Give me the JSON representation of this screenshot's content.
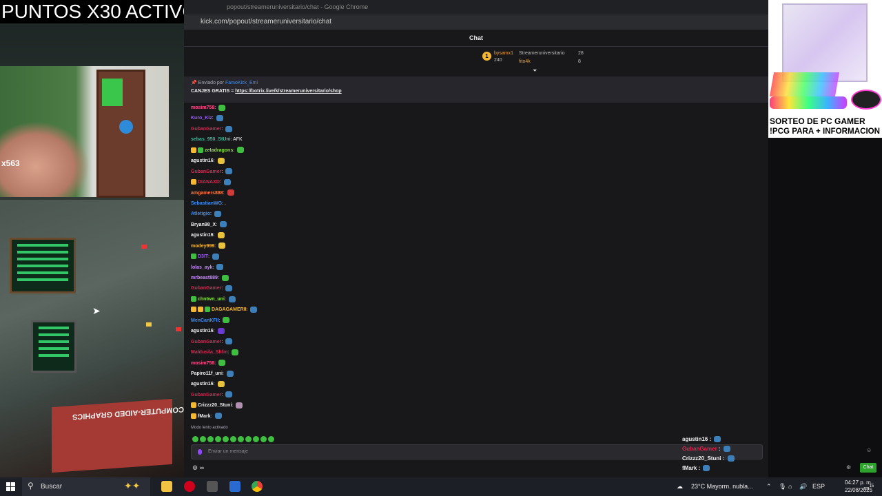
{
  "overlay": {
    "points_banner": "PUNTOS X30 ACTIVOS",
    "webcam_badge": "x563",
    "machine_sign": "COMPUTER-AIDED GRAPHICS",
    "promo_line1": "SORTEO DE PC GAMER",
    "promo_line2": "!PCG PARA + INFORMACION"
  },
  "browser": {
    "title": "popout/streameruniversitario/chat - Google Chrome",
    "url": "kick.com/popout/streameruniversitario/chat"
  },
  "chat": {
    "header": "Chat",
    "leaderboard": {
      "rank": "1",
      "user1": "bysamx1",
      "pts1": "240",
      "user2": "Streameruniversitario",
      "pts2": "28",
      "user3": "fito4k",
      "pts3": "8"
    },
    "pinned": {
      "sent_by_label": "Enviado por",
      "sent_by_user": "FamoKick_Emi",
      "text": "CANJES GRATIS",
      "link": "https://botrix.live/k/streameruniversitario/shop"
    },
    "messages": [
      {
        "user": "mosim758",
        "color": "#ff4f8b",
        "text": "",
        "emote": "#3fbf3f",
        "badges": []
      },
      {
        "user": "Kuro_Kiz",
        "color": "#9b5bff",
        "text": "",
        "emote": "#3d7fb8",
        "badges": []
      },
      {
        "user": "GubanGamer",
        "color": "#e0244f",
        "text": "",
        "emote": "#3d7fb8",
        "badges": []
      },
      {
        "user": "sebas_950_StUni",
        "color": "#2fbf9a",
        "text": "AFK",
        "emote": "",
        "badges": []
      },
      {
        "user": "zetadragons",
        "color": "#8be33a",
        "text": "",
        "emote": "#3fbf3f",
        "badges": [
          "#f5b82e",
          "#3fbf3f"
        ]
      },
      {
        "user": "agustin16",
        "color": "#efeff1",
        "text": "",
        "emote": "#e8c23a",
        "badges": []
      },
      {
        "user": "GubanGamer",
        "color": "#e0244f",
        "text": "",
        "emote": "#3d7fb8",
        "badges": []
      },
      {
        "user": "DIANAXD",
        "color": "#e0244f",
        "text": "",
        "emote": "#3d7fb8",
        "badges": [
          "#f5b82e"
        ]
      },
      {
        "user": "amgamers888",
        "color": "#ff7a3a",
        "text": "",
        "emote": "#d33a3a",
        "badges": []
      },
      {
        "user": "SebastianWG",
        "color": "#3c8ff5",
        "text": ".",
        "emote": "",
        "badges": []
      },
      {
        "user": "Atletigio",
        "color": "#3c8ff5",
        "text": "",
        "emote": "#3d7fb8",
        "badges": []
      },
      {
        "user": "Bryan98_X",
        "color": "#efeff1",
        "text": "",
        "emote": "#3d7fb8",
        "badges": []
      },
      {
        "user": "agustin16",
        "color": "#efeff1",
        "text": "",
        "emote": "#e8c23a",
        "badges": []
      },
      {
        "user": "modey999",
        "color": "#f5b82e",
        "text": "",
        "emote": "#e8c23a",
        "badges": []
      },
      {
        "user": "D3IT",
        "color": "#9b5bff",
        "text": "",
        "emote": "#3d7fb8",
        "badges": [
          "#3fbf3f"
        ]
      },
      {
        "user": "lolas_ayk",
        "color": "#c98bff",
        "text": "",
        "emote": "#3d7fb8",
        "badges": []
      },
      {
        "user": "mrbeast889",
        "color": "#c98bff",
        "text": "",
        "emote": "#3fbf3f",
        "badges": []
      },
      {
        "user": "GubanGamer",
        "color": "#e0244f",
        "text": "",
        "emote": "#3d7fb8",
        "badges": []
      },
      {
        "user": "chntwn_uni",
        "color": "#8be33a",
        "text": "",
        "emote": "#3d7fb8",
        "badges": [
          "#3fbf3f"
        ]
      },
      {
        "user": "DAGAGAMERII",
        "color": "#f5b82e",
        "text": "",
        "emote": "#3d7fb8",
        "badges": [
          "#f5b82e",
          "#f5b82e",
          "#3fbf3f"
        ]
      },
      {
        "user": "MenCanKFII",
        "color": "#3c8ff5",
        "text": "",
        "emote": "#3fbf3f",
        "badges": []
      },
      {
        "user": "agustin16",
        "color": "#efeff1",
        "text": "",
        "emote": "#6a3ad3",
        "badges": []
      },
      {
        "user": "GubanGamer",
        "color": "#e0244f",
        "text": "",
        "emote": "#3d7fb8",
        "badges": []
      },
      {
        "user": "Maldusila_Shfm",
        "color": "#e0244f",
        "text": "",
        "emote": "#3fbf3f",
        "badges": []
      },
      {
        "user": "mosim758",
        "color": "#ff4f8b",
        "text": "",
        "emote": "#3fbf3f",
        "badges": []
      },
      {
        "user": "Papiro11f_uni",
        "color": "#efeff1",
        "text": "",
        "emote": "#3d7fb8",
        "badges": []
      },
      {
        "user": "agustin16",
        "color": "#efeff1",
        "text": "",
        "emote": "#e8c23a",
        "badges": []
      },
      {
        "user": "GubanGamer",
        "color": "#e0244f",
        "text": "",
        "emote": "#3d7fb8",
        "badges": []
      },
      {
        "user": "Crizzz20_Stuni",
        "color": "#efeff1",
        "text": "",
        "emote": "#b08fb0",
        "badges": [
          "#f5b82e"
        ]
      },
      {
        "user": "fMark",
        "color": "#efeff1",
        "text": "",
        "emote": "#3d7fb8",
        "badges": [
          "#f5b82e"
        ]
      }
    ],
    "slow_mode": "Modo lento activado",
    "input_placeholder": "Enviar un mensaje",
    "bottom_icons": "∞"
  },
  "overlay_chat": [
    {
      "user": "agustin16",
      "color": "#efeff1"
    },
    {
      "user": "GubanGamer",
      "color": "#e0244f"
    },
    {
      "user": "Crizzz20_Stuni",
      "color": "#efeff1"
    },
    {
      "user": "fMark",
      "color": "#efeff1"
    }
  ],
  "overlay_chat_button": "Chat",
  "taskbar": {
    "search_label": "Buscar",
    "weather": "23°C  Mayorm. nubla...",
    "lang": "ESP",
    "time": "04:27 p. m.",
    "date": "22/08/2025",
    "notif_count": "15"
  }
}
